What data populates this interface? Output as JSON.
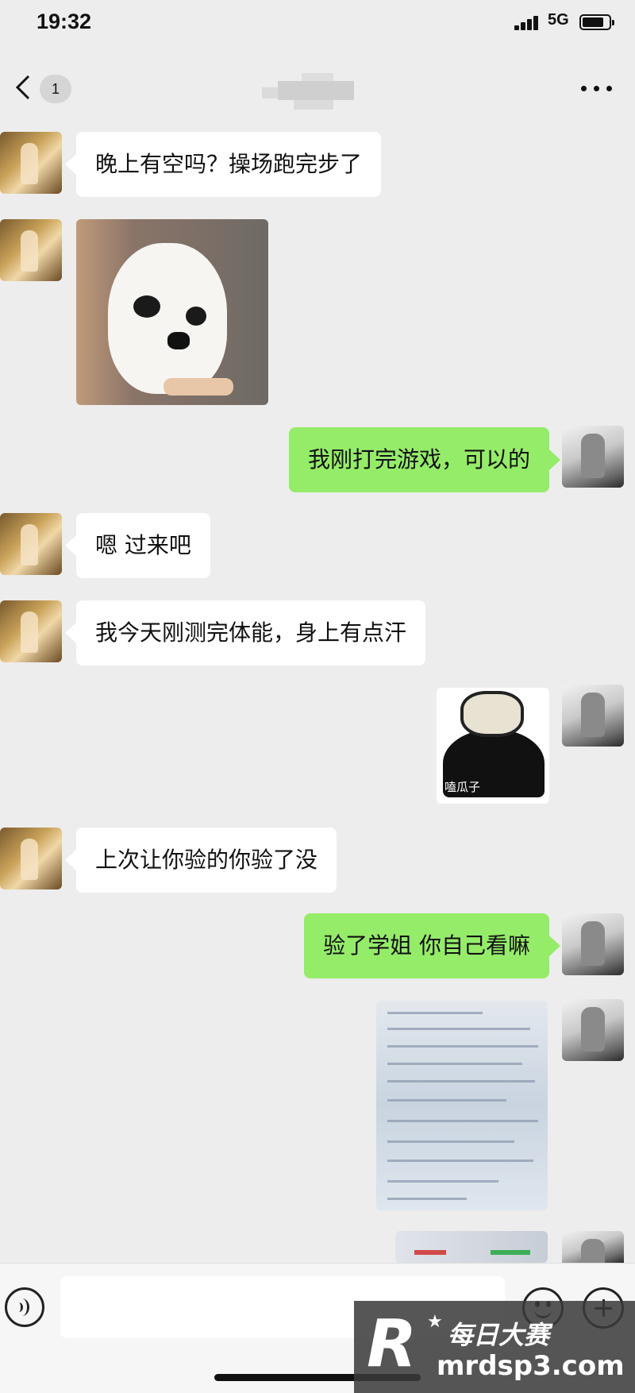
{
  "status_bar": {
    "time": "19:32",
    "network": "5G"
  },
  "header": {
    "back_label": "<",
    "unread_count": "1",
    "more_icon": "more-icon"
  },
  "messages": [
    {
      "side": "in",
      "type": "text",
      "text": "晚上有空吗？操场跑完步了"
    },
    {
      "side": "in",
      "type": "image",
      "image": "chihuahua meme photo"
    },
    {
      "side": "out",
      "type": "text",
      "text": "我刚打完游戏，可以的"
    },
    {
      "side": "in",
      "type": "text",
      "text": "嗯 过来吧"
    },
    {
      "side": "in",
      "type": "text",
      "text": "我今天刚测完体能，身上有点汗"
    },
    {
      "side": "out",
      "type": "sticker",
      "caption": "嗑瓜子"
    },
    {
      "side": "in",
      "type": "text",
      "text": "上次让你验的你验了没"
    },
    {
      "side": "out",
      "type": "text",
      "text": "验了学姐 你自己看嘛"
    },
    {
      "side": "out",
      "type": "image",
      "image": "medical test report photo"
    },
    {
      "side": "out",
      "type": "image",
      "image": "second report photo (partially visible)"
    }
  ],
  "input_bar": {
    "voice_icon": "voice-icon",
    "emoji_icon": "emoji-icon",
    "plus_icon": "plus-icon"
  },
  "watermark": {
    "brand": "每日大赛",
    "url": "mrdsp3.com",
    "logo": "R"
  },
  "colors": {
    "background": "#ededed",
    "outgoing_bubble": "#95ec69",
    "incoming_bubble": "#ffffff"
  }
}
